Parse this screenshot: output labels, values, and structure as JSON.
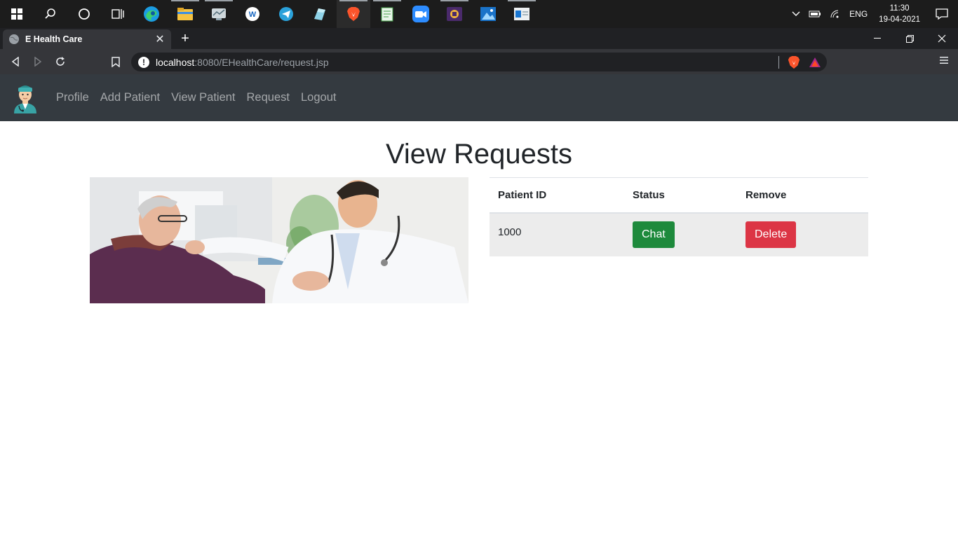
{
  "taskbar": {
    "icons": [
      {
        "name": "windows-start-icon"
      },
      {
        "name": "search-icon"
      },
      {
        "name": "cortana-icon"
      },
      {
        "name": "task-view-icon"
      },
      {
        "name": "edge-icon"
      },
      {
        "name": "file-explorer-icon"
      },
      {
        "name": "app-icon-1"
      },
      {
        "name": "app-icon-2"
      },
      {
        "name": "telegram-icon"
      },
      {
        "name": "app-icon-3"
      },
      {
        "name": "brave-icon"
      },
      {
        "name": "notepad-icon"
      },
      {
        "name": "zoom-icon"
      },
      {
        "name": "app-icon-4"
      },
      {
        "name": "photos-icon"
      },
      {
        "name": "app-icon-5"
      }
    ],
    "tray": {
      "language": "ENG",
      "time": "11:30",
      "date": "19-04-2021"
    }
  },
  "browser": {
    "tab_title": "E Health Care",
    "url_host": "localhost",
    "url_rest": ":8080/EHealthCare/request.jsp"
  },
  "navbar": {
    "links": [
      "Profile",
      "Add Patient",
      "View Patient",
      "Request",
      "Logout"
    ]
  },
  "page": {
    "heading": "View Requests",
    "table": {
      "headers": [
        "Patient ID",
        "Status",
        "Remove"
      ],
      "rows": [
        {
          "patient_id": "1000",
          "status_button": "Chat",
          "remove_button": "Delete"
        }
      ]
    }
  },
  "colors": {
    "navbar_bg": "#343a40",
    "chat_button": "#1e8a3c",
    "delete_button": "#dc3545"
  }
}
